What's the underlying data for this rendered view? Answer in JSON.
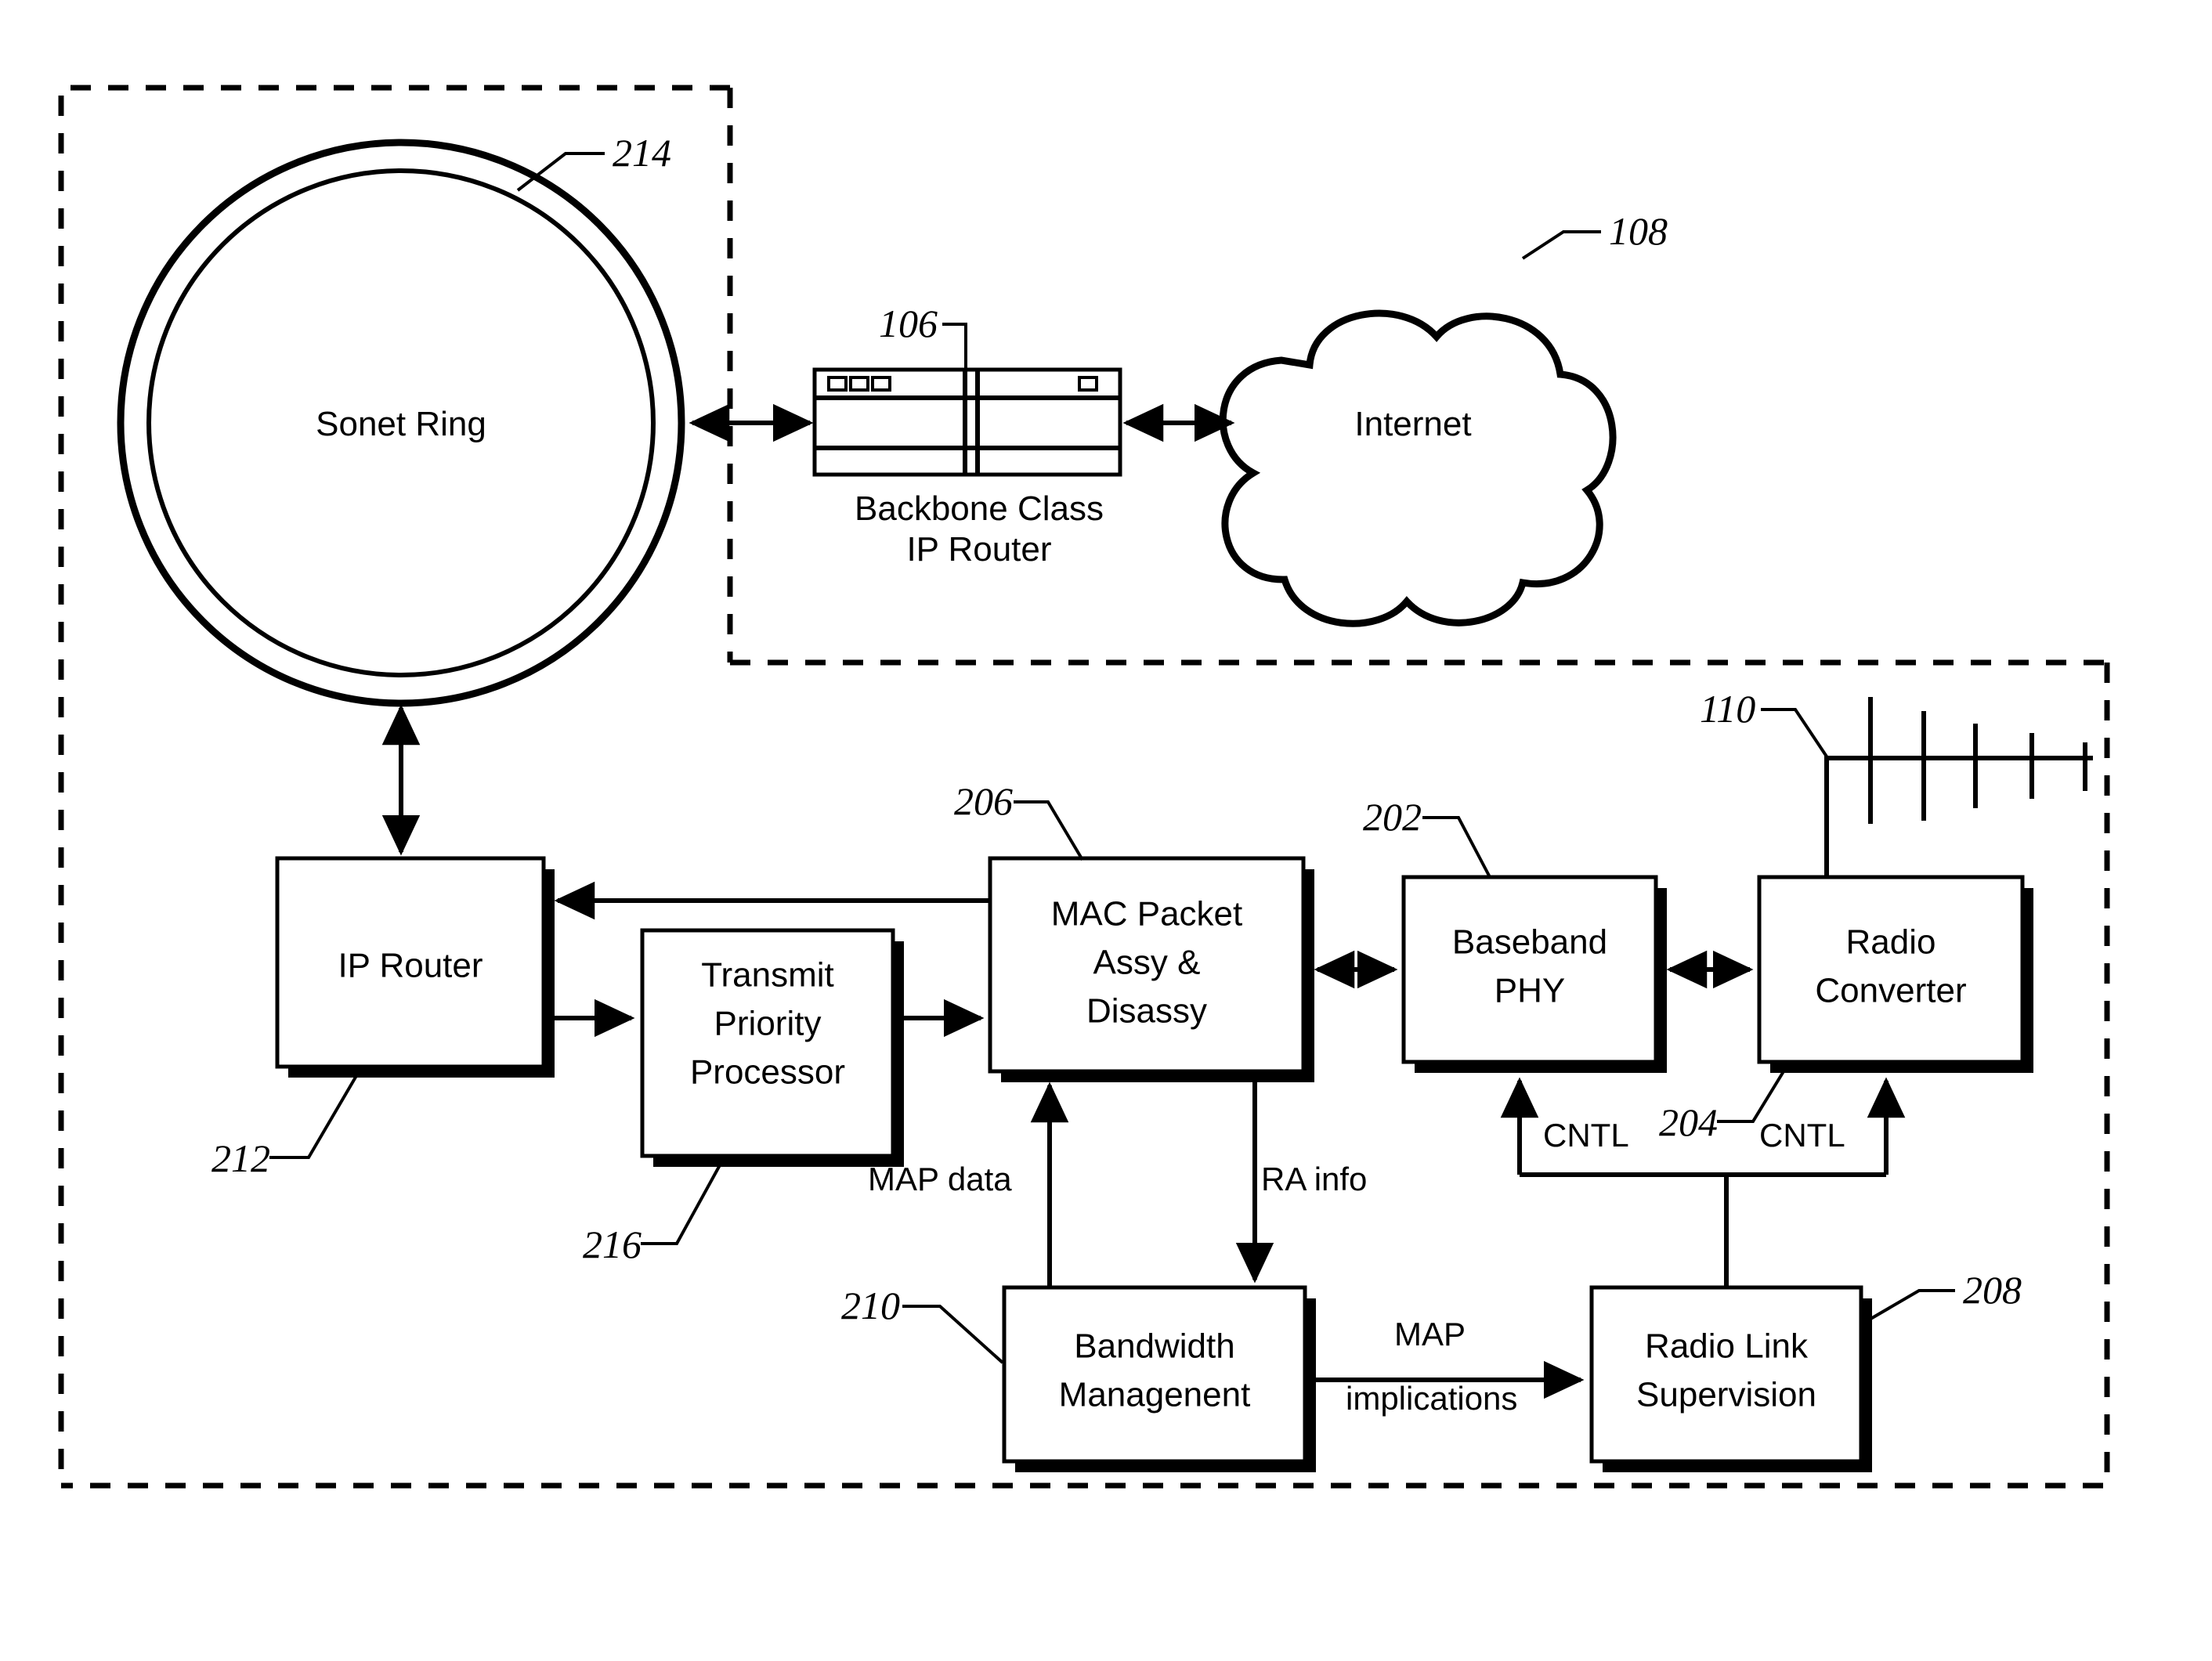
{
  "figure": {
    "type": "patent-block-diagram",
    "title": "Wireless IP access network block diagram"
  },
  "nodes": {
    "sonet_ring": {
      "label": "Sonet Ring",
      "ref": "214"
    },
    "backbone_router": {
      "label_line1": "Backbone Class",
      "label_line2": "IP Router",
      "ref": "106"
    },
    "internet": {
      "label": "Internet",
      "ref": "108"
    },
    "ip_router": {
      "label": "IP Router",
      "ref": "212"
    },
    "transmit_priority": {
      "label_line1": "Transmit",
      "label_line2": "Priority",
      "label_line3": "Processor",
      "ref": "216"
    },
    "mac_packet": {
      "label_line1": "MAC Packet",
      "label_line2": "Assy &",
      "label_line3": "Disassy",
      "ref": "206"
    },
    "baseband_phy": {
      "label_line1": "Baseband",
      "label_line2": "PHY",
      "ref": "202"
    },
    "radio_converter": {
      "label_line1": "Radio",
      "label_line2": "Converter",
      "ref": "204"
    },
    "antenna": {
      "ref": "110"
    },
    "bandwidth_mgmt": {
      "label_line1": "Bandwidth",
      "label_line2": "Managenent",
      "ref": "210"
    },
    "radio_link_sup": {
      "label_line1": "Radio Link",
      "label_line2": "Supervision",
      "ref": "208"
    }
  },
  "edge_labels": {
    "map_data": "MAP data",
    "ra_info": "RA info",
    "cntl_left": "CNTL",
    "cntl_right": "CNTL",
    "map_implications_line1": "MAP",
    "map_implications_line2": "implications"
  },
  "refs": {
    "r214": "214",
    "r106": "106",
    "r108": "108",
    "r212": "212",
    "r216": "216",
    "r206": "206",
    "r202": "202",
    "r204": "204",
    "r110": "110",
    "r210": "210",
    "r208": "208"
  },
  "colors": {
    "ink": "#000000",
    "paper": "#ffffff"
  }
}
